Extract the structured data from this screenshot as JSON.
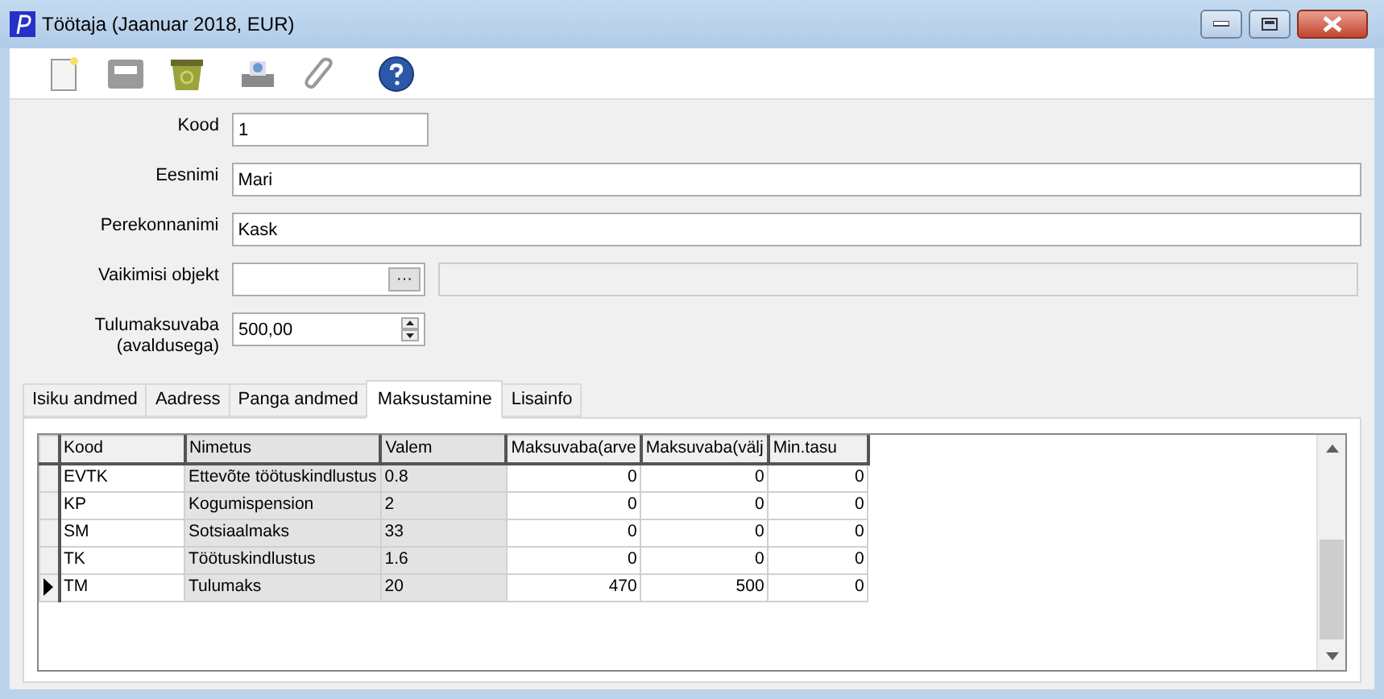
{
  "window": {
    "title": "Töötaja (Jaanuar 2018, EUR)"
  },
  "toolbar": [
    {
      "kind": "new"
    },
    {
      "kind": "form"
    },
    {
      "kind": "recycle"
    },
    {
      "kind": "print"
    },
    {
      "kind": "attach"
    },
    {
      "kind": "help"
    }
  ],
  "fields": [
    {
      "kind": "short",
      "label": "Kood",
      "value": "1"
    },
    {
      "kind": "text",
      "label": "Eesnimi",
      "value": "Mari"
    },
    {
      "kind": "text",
      "label": "Perekonnanimi",
      "value": "Kask"
    },
    {
      "kind": "lookup",
      "label": "Vaikimisi objekt",
      "button": "···"
    },
    {
      "kind": "spin",
      "label": "Tulumaksuvaba",
      "label_2": "(avaldusega)",
      "value": "500,00"
    }
  ],
  "tabs": [
    {
      "label": "Isiku andmed",
      "selected": false
    },
    {
      "label": "Aadress",
      "selected": false
    },
    {
      "label": "Panga andmed",
      "selected": false
    },
    {
      "label": "Maksustamine",
      "selected": true
    },
    {
      "label": "Lisainfo",
      "selected": false
    }
  ],
  "table": {
    "columns": [
      {
        "label": "Kood",
        "kind": "text",
        "readonly": false
      },
      {
        "label": "Nimetus",
        "kind": "text",
        "readonly": true
      },
      {
        "label": "Valem",
        "kind": "text",
        "readonly": true
      },
      {
        "label": "Maksuvaba(arve",
        "kind": "number",
        "readonly": false
      },
      {
        "label": "Maksuvaba(välj",
        "kind": "number",
        "readonly": false
      },
      {
        "label": "Min.tasu",
        "kind": "number",
        "readonly": false
      }
    ],
    "rows": [
      {
        "cells": [
          "EVTK",
          "Ettevõte töötuskindlustus",
          "0.8",
          "0",
          "0",
          "0"
        ],
        "selected": false
      },
      {
        "cells": [
          "KP",
          "Kogumispension",
          "2",
          "0",
          "0",
          "0"
        ],
        "selected": false
      },
      {
        "cells": [
          "SM",
          "Sotsiaalmaks",
          "33",
          "0",
          "0",
          "0"
        ],
        "selected": false
      },
      {
        "cells": [
          "TK",
          "Töötuskindlustus",
          "1.6",
          "0",
          "0",
          "0"
        ],
        "selected": false
      },
      {
        "cells": [
          "TM",
          "Tulumaks",
          "20",
          "470",
          "500",
          "0"
        ],
        "selected": true
      }
    ]
  }
}
